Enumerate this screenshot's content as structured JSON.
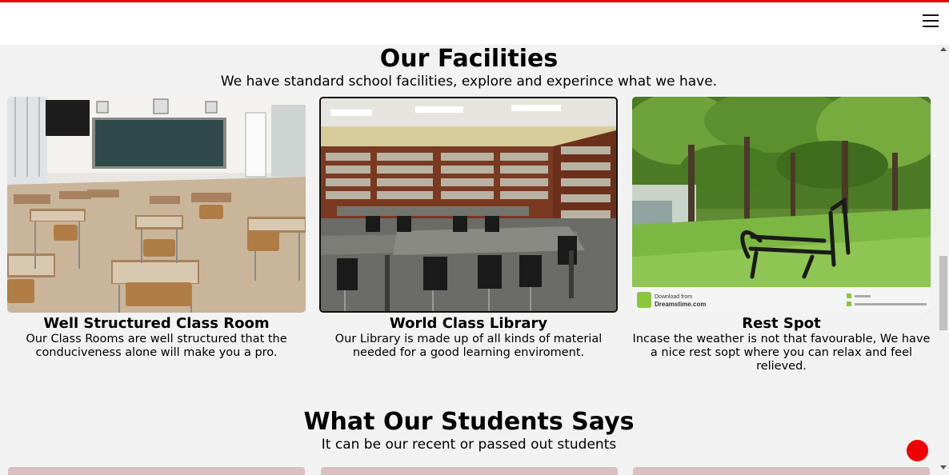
{
  "nav": {
    "menu_icon": "hamburger-menu-icon"
  },
  "facilities": {
    "title": "Our Facilities",
    "subtitle": "We have standard school facilities, explore and experince what we have.",
    "cards": [
      {
        "title": "Well Structured Class Room",
        "description": "Our Class Rooms are well structured that the conduciveness alone will make you a pro."
      },
      {
        "title": "World Class Library",
        "description": "Our Library is made up of all kinds of material needed for a good learning enviroment."
      },
      {
        "title": "Rest Spot",
        "description": "Incase the weather is not that favourable, We have a nice rest sopt where you can relax and feel relieved.",
        "watermark": "Download from Dreamstime.com"
      }
    ]
  },
  "testimonials": {
    "title": "What Our Students Says",
    "subtitle": "It can be our recent or passed out students"
  },
  "colors": {
    "accent": "#e00000",
    "fab": "#f00000"
  }
}
